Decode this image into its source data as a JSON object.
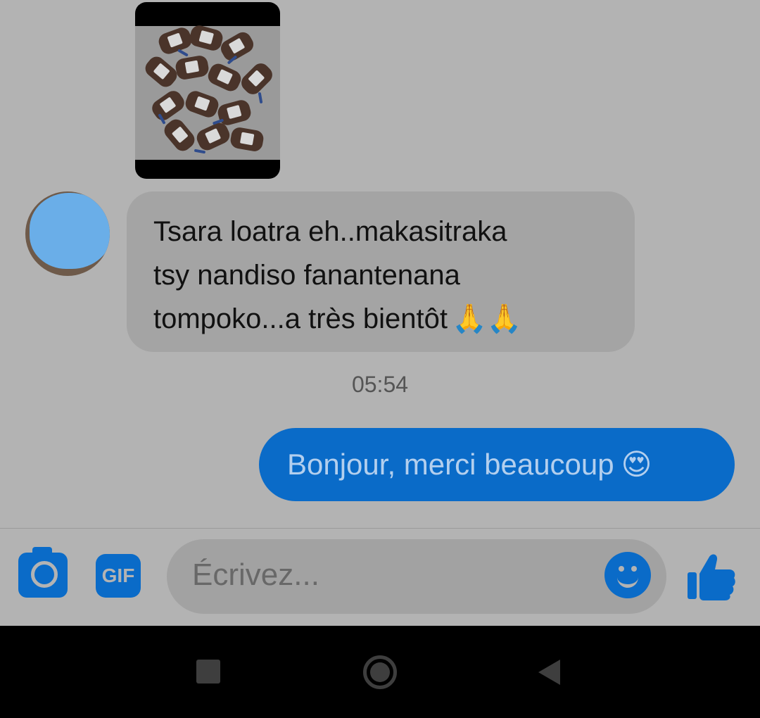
{
  "conversation": {
    "incoming_message": {
      "lines": [
        "Tsara loatra eh..makasitraka",
        "tsy nandiso fanantenana",
        "tompoko...a très bientôt"
      ],
      "emoji": "🙏🙏"
    },
    "timestamp": "05:54",
    "outgoing_message": {
      "text": "Bonjour, merci beaucoup",
      "emoji": "😍"
    }
  },
  "composer": {
    "placeholder": "Écrivez...",
    "gif_label": "GIF",
    "icons": {
      "camera": "camera-icon",
      "gif": "gif-icon",
      "emoji": "emoji-icon",
      "like": "thumbs-up-icon"
    }
  },
  "navigation_bar": {
    "icons": [
      "recent-apps-icon",
      "home-icon",
      "back-icon"
    ]
  },
  "colors": {
    "accent": "#0a6bc8",
    "background": "#b3b3b3",
    "incoming_bubble": "#a4a4a4",
    "outgoing_text": "#b3cfee"
  }
}
